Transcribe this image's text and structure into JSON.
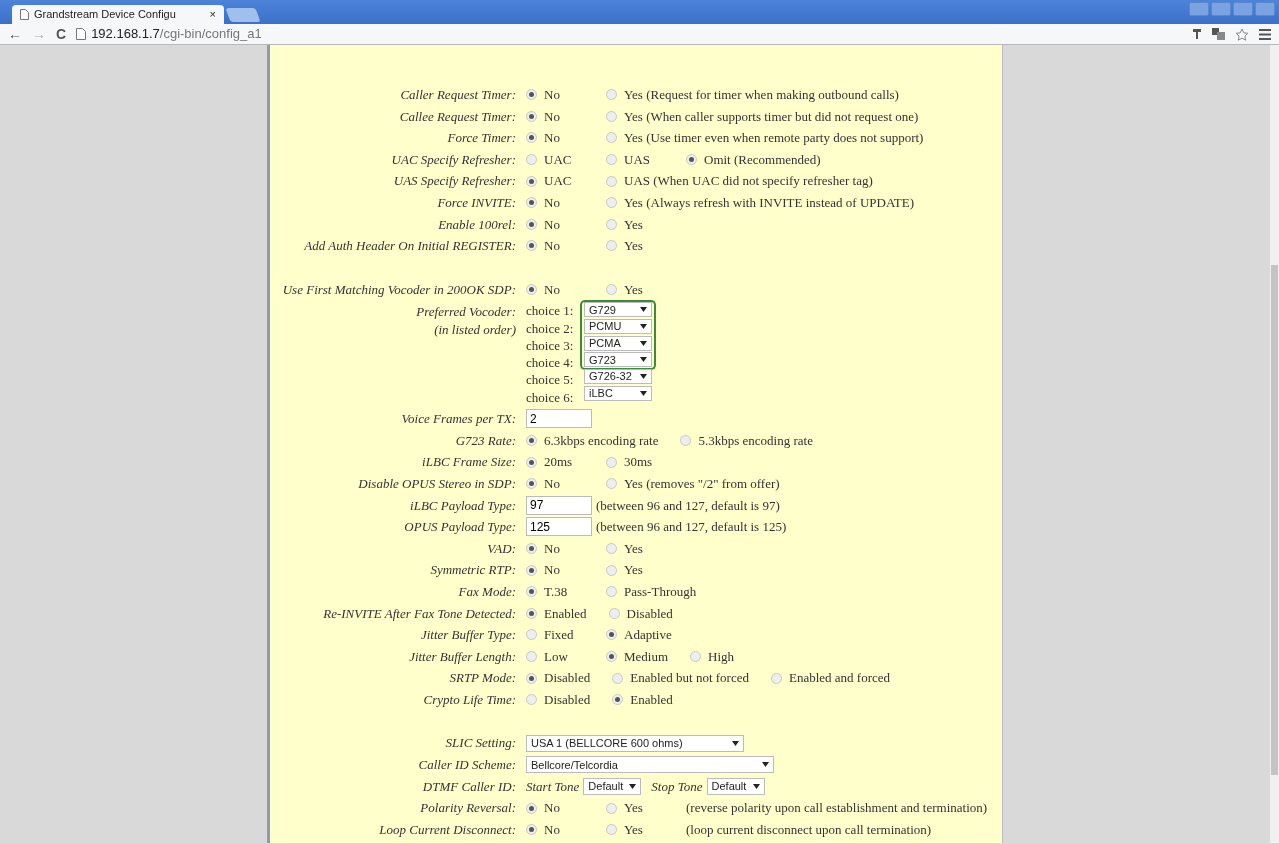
{
  "browser": {
    "tab_title": "Grandstream Device Configu",
    "tab_close": "×",
    "nav": {
      "back": "←",
      "forward": "→",
      "reload": "C"
    },
    "url_host": "192.168.1.7",
    "url_path": "/cgi-bin/config_a1"
  },
  "settings": [
    {
      "kind": "radio",
      "label": "Caller Request Timer:",
      "options": [
        {
          "label": "No",
          "selected": true
        },
        {
          "label": "Yes (Request for timer when making outbound calls)",
          "selected": false
        }
      ]
    },
    {
      "kind": "radio",
      "label": "Callee Request Timer:",
      "options": [
        {
          "label": "No",
          "selected": true
        },
        {
          "label": "Yes (When caller supports timer but did not request one)",
          "selected": false
        }
      ]
    },
    {
      "kind": "radio",
      "label": "Force Timer:",
      "options": [
        {
          "label": "No",
          "selected": true
        },
        {
          "label": "Yes (Use timer even when remote party does not support)",
          "selected": false
        }
      ]
    },
    {
      "kind": "radio",
      "label": "UAC Specify Refresher:",
      "options": [
        {
          "label": "UAC",
          "selected": false
        },
        {
          "label": "UAS",
          "selected": false
        },
        {
          "label": "Omit (Recommended)",
          "selected": true
        }
      ]
    },
    {
      "kind": "radio",
      "label": "UAS Specify Refresher:",
      "options": [
        {
          "label": "UAC",
          "selected": true
        },
        {
          "label": "UAS (When UAC did not specify refresher tag)",
          "selected": false
        }
      ]
    },
    {
      "kind": "radio",
      "label": "Force INVITE:",
      "options": [
        {
          "label": "No",
          "selected": true
        },
        {
          "label": "Yes (Always refresh with INVITE instead of UPDATE)",
          "selected": false
        }
      ]
    },
    {
      "kind": "radio",
      "label": "Enable 100rel:",
      "options": [
        {
          "label": "No",
          "selected": true
        },
        {
          "label": "Yes",
          "selected": false
        }
      ]
    },
    {
      "kind": "radio",
      "label": "Add Auth Header On Initial REGISTER:",
      "options": [
        {
          "label": "No",
          "selected": true
        },
        {
          "label": "Yes",
          "selected": false
        }
      ]
    },
    {
      "kind": "spacer"
    },
    {
      "kind": "radio",
      "label": "Use First Matching Vocoder in 200OK SDP:",
      "options": [
        {
          "label": "No",
          "selected": true
        },
        {
          "label": "Yes",
          "selected": false
        }
      ]
    },
    {
      "kind": "choices",
      "label": "Preferred Vocoder:",
      "sublabel": "(in listed order)",
      "choices": [
        {
          "label": "choice 1:",
          "value": "G729",
          "highlighted": true
        },
        {
          "label": "choice 2:",
          "value": "PCMU",
          "highlighted": true
        },
        {
          "label": "choice 3:",
          "value": "PCMA",
          "highlighted": true
        },
        {
          "label": "choice 4:",
          "value": "G723",
          "highlighted": true
        },
        {
          "label": "choice 5:",
          "value": "G726-32",
          "highlighted": false
        },
        {
          "label": "choice 6:",
          "value": "iLBC",
          "highlighted": false
        }
      ]
    },
    {
      "kind": "input",
      "label": "Voice Frames per TX:",
      "value": "2"
    },
    {
      "kind": "radio",
      "label": "G723 Rate:",
      "options": [
        {
          "label": "6.3kbps encoding rate",
          "selected": true
        },
        {
          "label": "5.3kbps encoding rate",
          "selected": false
        }
      ]
    },
    {
      "kind": "radio",
      "label": "iLBC Frame Size:",
      "options": [
        {
          "label": "20ms",
          "selected": true
        },
        {
          "label": "30ms",
          "selected": false
        }
      ]
    },
    {
      "kind": "radio",
      "label": "Disable OPUS Stereo in SDP:",
      "options": [
        {
          "label": "No",
          "selected": true
        },
        {
          "label": "Yes (removes \"/2\" from offer)",
          "selected": false
        }
      ]
    },
    {
      "kind": "input",
      "label": "iLBC Payload Type:",
      "value": "97",
      "note": "(between 96 and 127, default is 97)"
    },
    {
      "kind": "input",
      "label": "OPUS Payload Type:",
      "value": "125",
      "note": "(between 96 and 127, default is 125)"
    },
    {
      "kind": "radio",
      "label": "VAD:",
      "options": [
        {
          "label": "No",
          "selected": true
        },
        {
          "label": "Yes",
          "selected": false
        }
      ]
    },
    {
      "kind": "radio",
      "label": "Symmetric RTP:",
      "options": [
        {
          "label": "No",
          "selected": true
        },
        {
          "label": "Yes",
          "selected": false
        }
      ]
    },
    {
      "kind": "radio",
      "label": "Fax Mode:",
      "options": [
        {
          "label": "T.38",
          "selected": true
        },
        {
          "label": "Pass-Through",
          "selected": false
        }
      ]
    },
    {
      "kind": "radio",
      "label": "Re-INVITE After Fax Tone Detected:",
      "options": [
        {
          "label": "Enabled",
          "selected": true
        },
        {
          "label": "Disabled",
          "selected": false
        }
      ]
    },
    {
      "kind": "radio",
      "label": "Jitter Buffer Type:",
      "options": [
        {
          "label": "Fixed",
          "selected": false
        },
        {
          "label": "Adaptive",
          "selected": true
        }
      ]
    },
    {
      "kind": "radio",
      "label": "Jitter Buffer Length:",
      "options": [
        {
          "label": "Low",
          "selected": false
        },
        {
          "label": "Medium",
          "selected": true
        },
        {
          "label": "High",
          "selected": false
        }
      ]
    },
    {
      "kind": "radio",
      "label": "SRTP Mode:",
      "options": [
        {
          "label": "Disabled",
          "selected": true
        },
        {
          "label": "Enabled but not forced",
          "selected": false
        },
        {
          "label": "Enabled and forced",
          "selected": false
        }
      ]
    },
    {
      "kind": "radio",
      "label": "Crypto Life Time:",
      "options": [
        {
          "label": "Disabled",
          "selected": false
        },
        {
          "label": "Enabled",
          "selected": true
        }
      ]
    },
    {
      "kind": "spacer"
    },
    {
      "kind": "select",
      "label": "SLIC Setting:",
      "value": "USA 1 (BELLCORE 600 ohms)"
    },
    {
      "kind": "select",
      "label": "Caller ID Scheme:",
      "value": "Bellcore/Telcordia"
    },
    {
      "kind": "tones",
      "label": "DTMF Caller ID:",
      "tones": [
        {
          "label": "Start Tone",
          "value": "Default"
        },
        {
          "label": "Stop Tone",
          "value": "Default"
        }
      ]
    },
    {
      "kind": "radio",
      "label": "Polarity Reversal:",
      "options": [
        {
          "label": "No",
          "selected": true
        },
        {
          "label": "Yes",
          "selected": false
        }
      ],
      "note": "(reverse polarity upon call establishment and termination)"
    },
    {
      "kind": "radio",
      "label": "Loop Current Disconnect:",
      "options": [
        {
          "label": "No",
          "selected": true
        },
        {
          "label": "Yes",
          "selected": false
        }
      ],
      "note": "(loop current disconnect upon call termination)"
    }
  ]
}
